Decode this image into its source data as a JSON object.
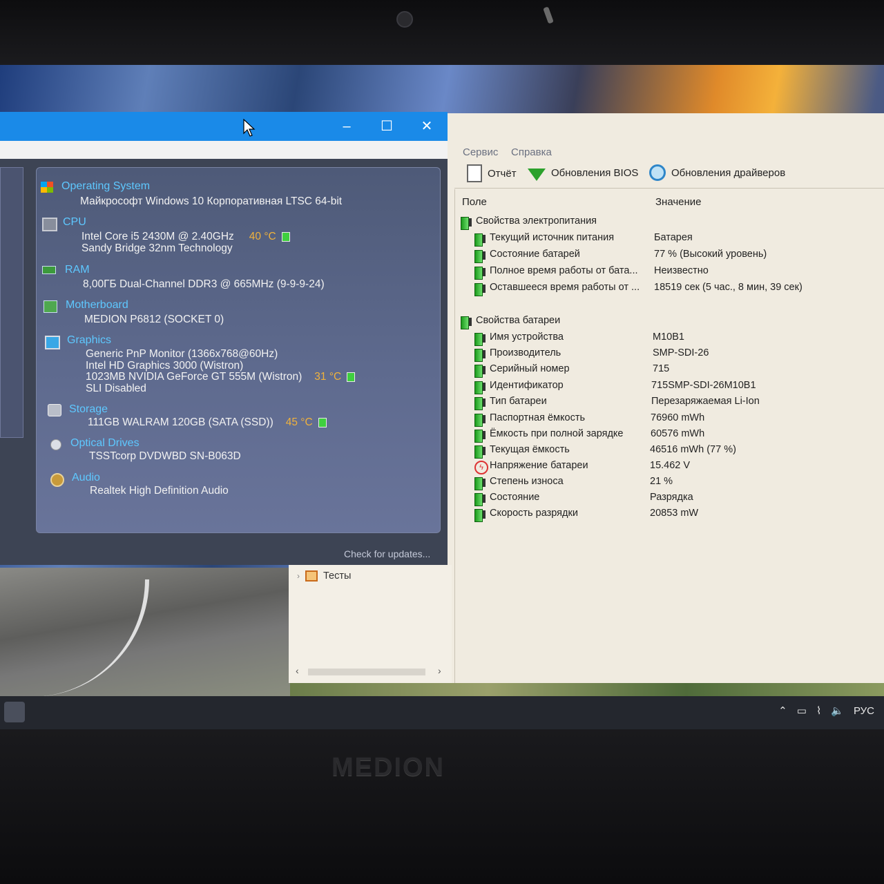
{
  "speccy": {
    "sections": [
      {
        "id": "os",
        "title": "Operating System",
        "icon": "windows-logo-icon",
        "lines": [
          "Майкрософт Windows 10 Корпоративная LTSC 64-bit"
        ]
      },
      {
        "id": "cpu",
        "title": "CPU",
        "icon": "cpu-icon",
        "lines": [
          "Intel Core i5 2430M @ 2.40GHz",
          "Sandy Bridge 32nm Technology"
        ],
        "temp": "40 °C"
      },
      {
        "id": "ram",
        "title": "RAM",
        "icon": "ram-icon",
        "lines": [
          "8,00ГБ Dual-Channel DDR3 @ 665MHz (9-9-9-24)"
        ]
      },
      {
        "id": "mb",
        "title": "Motherboard",
        "icon": "motherboard-icon",
        "lines": [
          "MEDION P6812 (SOCKET 0)"
        ]
      },
      {
        "id": "gpu",
        "title": "Graphics",
        "icon": "monitor-icon",
        "lines": [
          "Generic PnP Monitor (1366x768@60Hz)",
          "Intel HD Graphics 3000 (Wistron)",
          "1023MB NVIDIA GeForce GT 555M (Wistron)",
          "SLI Disabled"
        ],
        "temp": "31 °C"
      },
      {
        "id": "storage",
        "title": "Storage",
        "icon": "hdd-icon",
        "lines": [
          "111GB WALRAM 120GB (SATA (SSD))"
        ],
        "temp": "45 °C"
      },
      {
        "id": "optical",
        "title": "Optical Drives",
        "icon": "disc-icon",
        "lines": [
          "TSSTcorp DVDWBD SN-B063D"
        ]
      },
      {
        "id": "audio",
        "title": "Audio",
        "icon": "speaker-icon",
        "lines": [
          "Realtek High Definition Audio"
        ]
      }
    ],
    "check_updates": "Check for updates..."
  },
  "aida": {
    "menu": [
      "Сервис",
      "Справка"
    ],
    "toolbar": {
      "report": "Отчёт",
      "bios": "Обновления BIOS",
      "drivers": "Обновления драйверов"
    },
    "columns": {
      "field": "Поле",
      "value": "Значение"
    },
    "group1": {
      "title": "Свойства электропитания",
      "rows": [
        {
          "label": "Текущий источник питания",
          "value": "Батарея"
        },
        {
          "label": "Состояние батарей",
          "value": "77 % (Высокий уровень)"
        },
        {
          "label": "Полное время работы от бата...",
          "value": "Неизвестно"
        },
        {
          "label": "Оставшееся время работы от ...",
          "value": "18519 сек (5 час., 8 мин, 39 сек)"
        }
      ]
    },
    "group2": {
      "title": "Свойства батареи",
      "rows": [
        {
          "label": "Имя устройства",
          "value": "M10B1"
        },
        {
          "label": "Производитель",
          "value": "SMP-SDI-26"
        },
        {
          "label": "Серийный номер",
          "value": "715"
        },
        {
          "label": "Идентификатор",
          "value": "715SMP-SDI-26M10B1"
        },
        {
          "label": "Тип батареи",
          "value": "Перезаряжаемая Li-Ion"
        },
        {
          "label": "Паспортная ёмкость",
          "value": "76960 mWh"
        },
        {
          "label": "Ёмкость при полной зарядке",
          "value": "60576 mWh"
        },
        {
          "label": "Текущая ёмкость",
          "value": "46516 mWh  (77 %)"
        },
        {
          "label": "Напряжение батареи",
          "value": "15.462 V"
        },
        {
          "label": "Степень износа",
          "value": "21 %"
        },
        {
          "label": "Состояние",
          "value": "Разрядка"
        },
        {
          "label": "Скорость разрядки",
          "value": "20853 mW"
        }
      ]
    },
    "tree_item": "Тесты"
  },
  "taskbar": {
    "language": "РУС"
  },
  "brand": "MEDION"
}
